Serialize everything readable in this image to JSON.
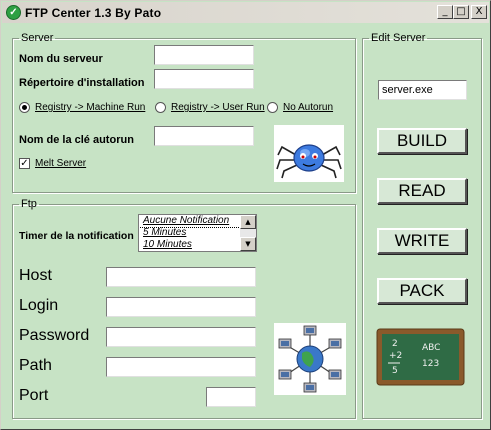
{
  "window": {
    "title": "FTP Center 1.3 By Pato",
    "minimize": "_",
    "maximize": "□",
    "close": "X"
  },
  "server": {
    "legend": "Server",
    "server_name_label": "Nom du serveur",
    "server_name_value": "",
    "install_dir_label": "Répertoire d'installation",
    "install_dir_value": "",
    "radio_machine": "Registry -> Machine Run",
    "radio_user": "Registry -> User Run",
    "radio_none": "No Autorun",
    "autorun_key_label": "Nom de la clé autorun",
    "autorun_key_value": "",
    "melt_label": "Melt Server",
    "melt_checked": true
  },
  "ftp": {
    "legend": "Ftp",
    "timer_label": "Timer de la notification",
    "timer_options": [
      "Aucune Notification",
      "5 Minutes",
      "10 Minutes"
    ],
    "host_label": "Host",
    "host_value": "",
    "login_label": "Login",
    "login_value": "",
    "password_label": "Password",
    "password_value": "",
    "path_label": "Path",
    "path_value": "",
    "port_label": "Port",
    "port_value": ""
  },
  "edit": {
    "legend": "Edit Server",
    "filename": "server.exe",
    "build": "BUILD",
    "read": "READ",
    "write": "WRITE",
    "pack": "PACK"
  },
  "chalkboard": {
    "top_left": "2",
    "top_right": "ABC",
    "mid_left": "+2",
    "bottom_right": "123",
    "bottom_left": "5"
  }
}
